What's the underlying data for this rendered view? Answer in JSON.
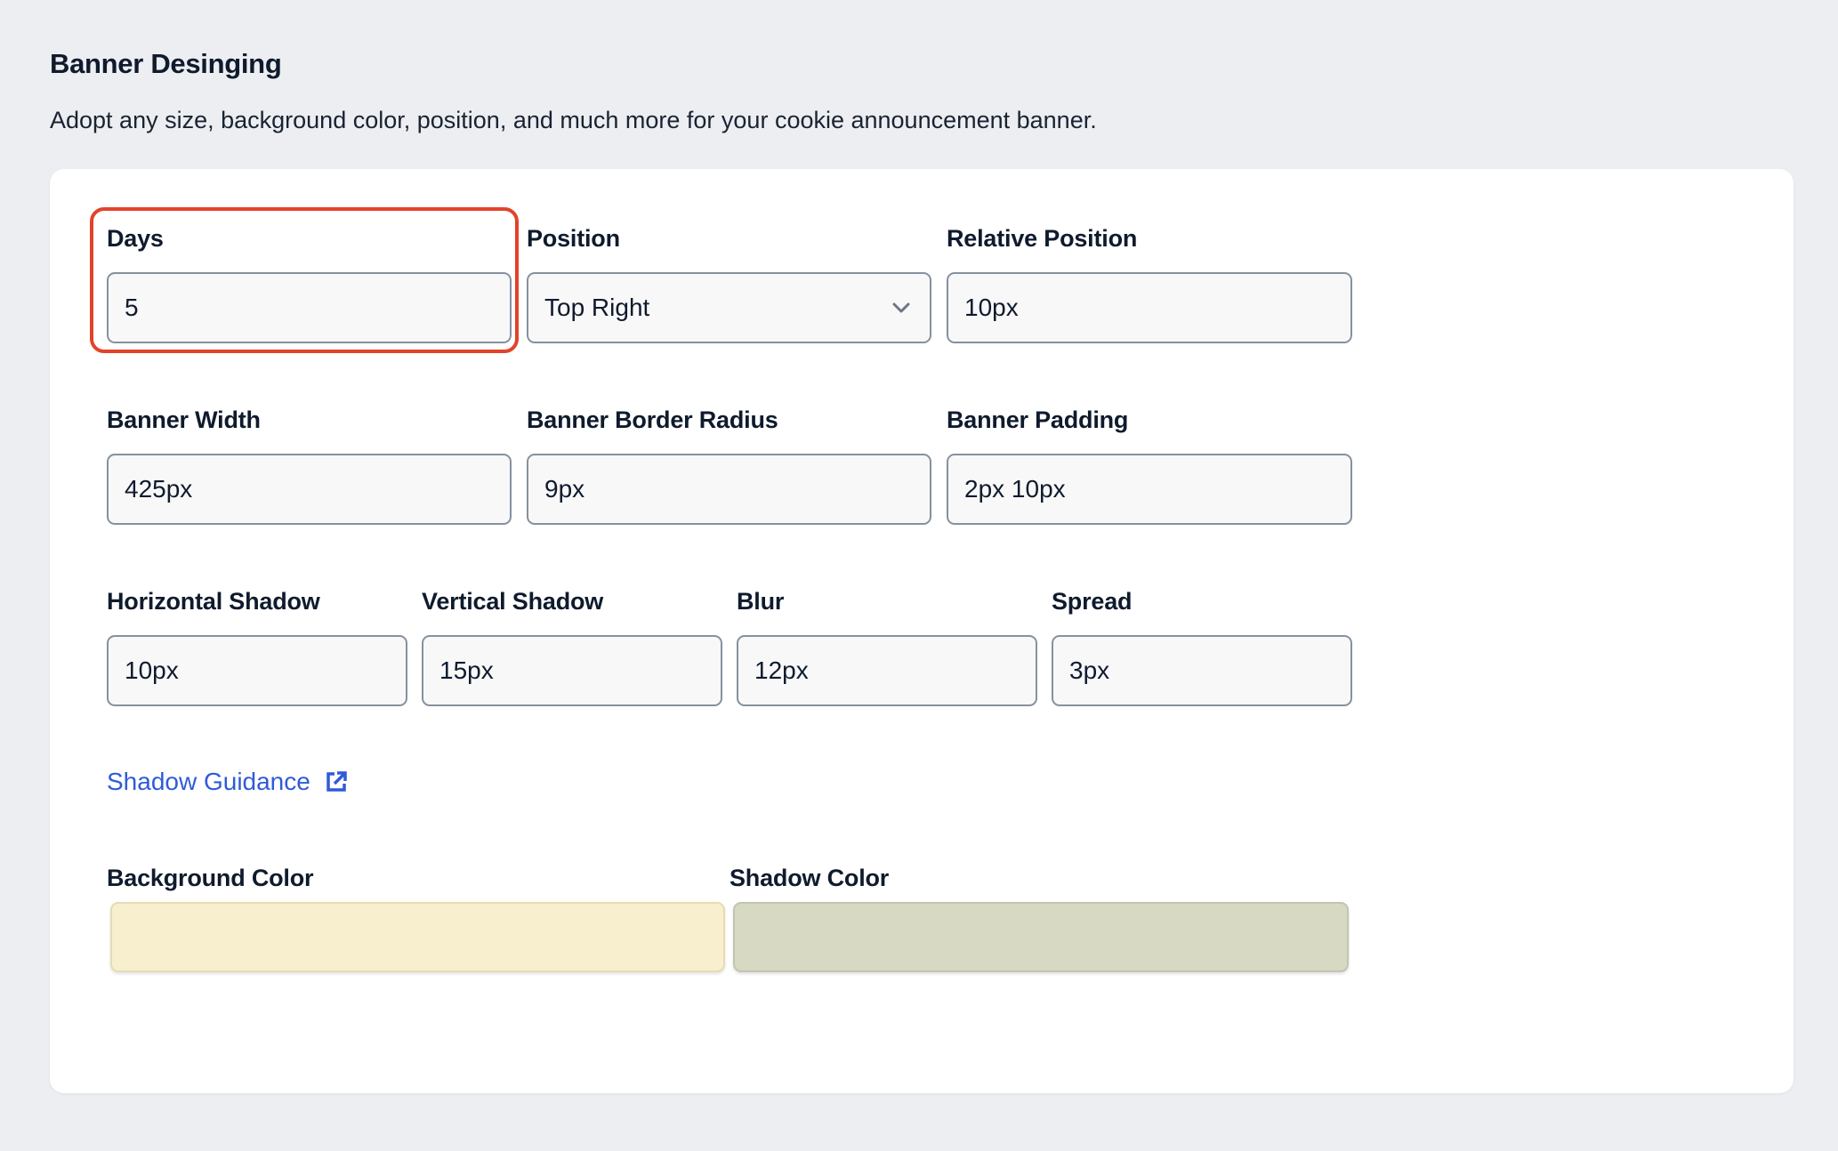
{
  "header": {
    "title": "Banner Desinging",
    "subtitle": "Adopt any size, background color, position, and much more for your cookie announcement banner."
  },
  "fields": {
    "days": {
      "label": "Days",
      "value": "5"
    },
    "position": {
      "label": "Position",
      "value": "Top Right"
    },
    "relative_position": {
      "label": "Relative Position",
      "value": "10px"
    },
    "banner_width": {
      "label": "Banner Width",
      "value": "425px"
    },
    "banner_border_radius": {
      "label": "Banner Border Radius",
      "value": "9px"
    },
    "banner_padding": {
      "label": "Banner Padding",
      "value": "2px 10px"
    },
    "horizontal_shadow": {
      "label": "Horizontal Shadow",
      "value": "10px"
    },
    "vertical_shadow": {
      "label": "Vertical Shadow",
      "value": "15px"
    },
    "blur": {
      "label": "Blur",
      "value": "12px"
    },
    "spread": {
      "label": "Spread",
      "value": "3px"
    }
  },
  "link": {
    "label": "Shadow Guidance",
    "icon": "external-link-icon"
  },
  "colors": {
    "background": {
      "label": "Background Color",
      "value": "#f8efcf"
    },
    "shadow": {
      "label": "Shadow Color",
      "value": "#d7d9c3"
    }
  },
  "highlight_color": "#e2432a",
  "link_color": "#2f5bd8"
}
